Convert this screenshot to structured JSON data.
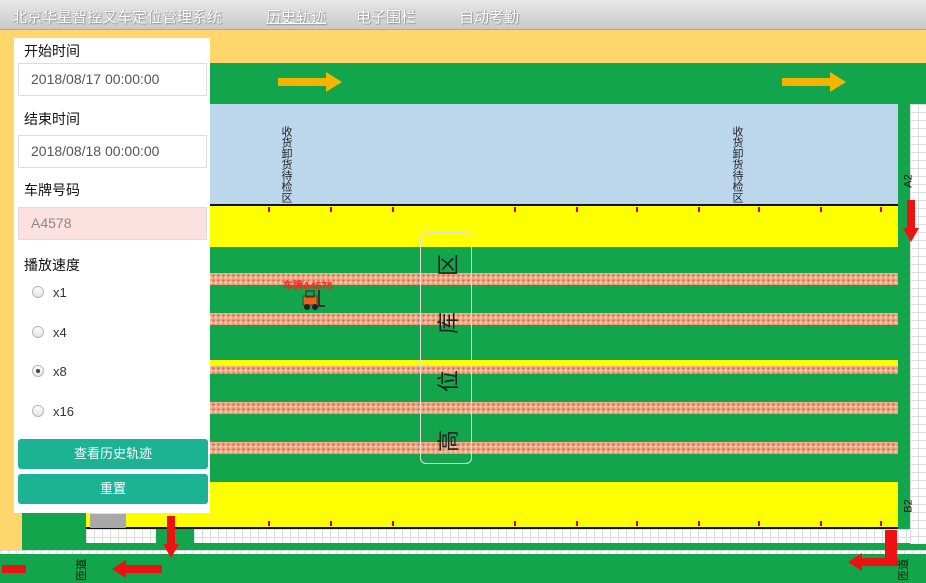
{
  "nav": {
    "title": "北京华星智控叉车定位管理系统",
    "history": "历史轨迹",
    "fence": "电子围栏",
    "attendance": "自动考勤"
  },
  "panel": {
    "start_label": "开始时间",
    "start_value": "2018/08/17 00:00:00",
    "end_label": "结束时间",
    "end_value": "2018/08/18 00:00:00",
    "plate_label": "车牌号码",
    "plate_value": "A4578",
    "speed_label": "播放速度",
    "speeds": [
      "x1",
      "x4",
      "x8",
      "x16"
    ],
    "speed_selected": "x8",
    "query_button": "查看历史轨迹",
    "reset_button": "重置"
  },
  "map": {
    "zone_label": "收货卸货待检区",
    "center_chars": [
      "区",
      "库",
      "位",
      "高"
    ],
    "truck_label": "车牌A4578",
    "side_a2": "A2",
    "side_b2": "B2",
    "bottom_left_label": "匝道",
    "bottom_right_label": "匝道"
  },
  "colors": {
    "floor": "#12a54b",
    "lane": "#ffff00",
    "zone": "#bcd6ec",
    "button": "#1bb394",
    "arrow_yellow": "#f5b400",
    "arrow_red": "#ee1111"
  }
}
